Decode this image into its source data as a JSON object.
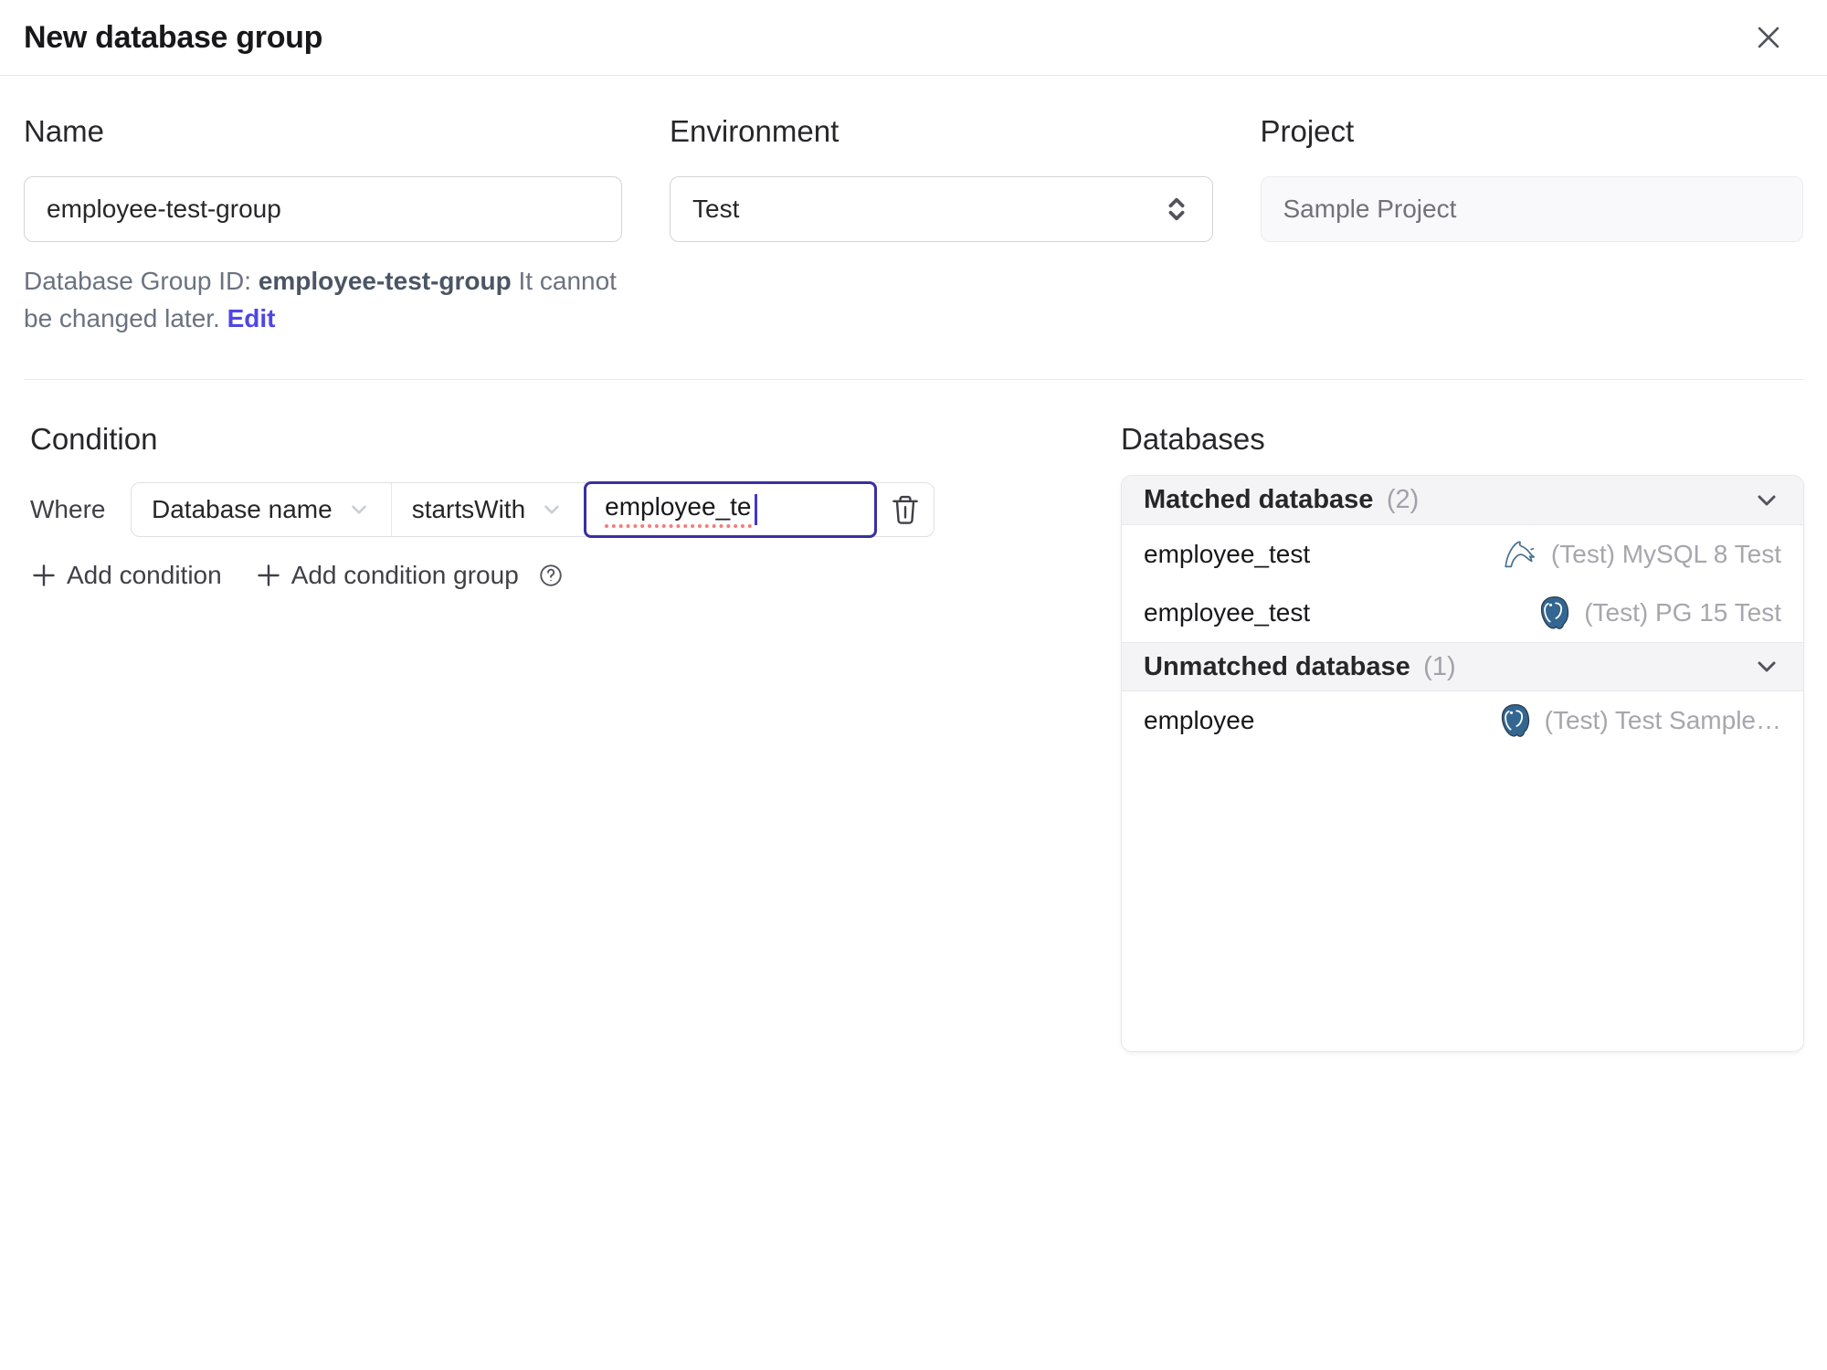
{
  "dialog": {
    "title": "New database group"
  },
  "form": {
    "name": {
      "label": "Name",
      "value": "employee-test-group"
    },
    "environment": {
      "label": "Environment",
      "value": "Test"
    },
    "project": {
      "label": "Project",
      "value": "Sample Project"
    },
    "group_id_note": {
      "prefix": "Database Group ID: ",
      "id": "employee-test-group",
      "suffix": " It cannot be changed later. ",
      "edit_label": "Edit"
    }
  },
  "condition": {
    "heading": "Condition",
    "where_label": "Where",
    "field": "Database name",
    "operator": "startsWith",
    "value": "employee_te",
    "add_condition_label": "Add condition",
    "add_condition_group_label": "Add condition group"
  },
  "databases": {
    "heading": "Databases",
    "groups": [
      {
        "label": "Matched database",
        "count": "(2)",
        "rows": [
          {
            "name": "employee_test",
            "engine": "mysql",
            "instance": "(Test) MySQL 8 Test"
          },
          {
            "name": "employee_test",
            "engine": "postgres",
            "instance": "(Test) PG 15 Test"
          }
        ]
      },
      {
        "label": "Unmatched database",
        "count": "(1)",
        "rows": [
          {
            "name": "employee",
            "engine": "postgres",
            "instance": "(Test) Test Sample…"
          }
        ]
      }
    ]
  },
  "colors": {
    "accent_link": "#4f46e5",
    "focus_border": "#3730a3",
    "mysql_icon": "#47708e",
    "postgres_icon": "#336791",
    "panel_header_bg": "#f4f4f6",
    "muted_text": "#a6a6ad"
  }
}
